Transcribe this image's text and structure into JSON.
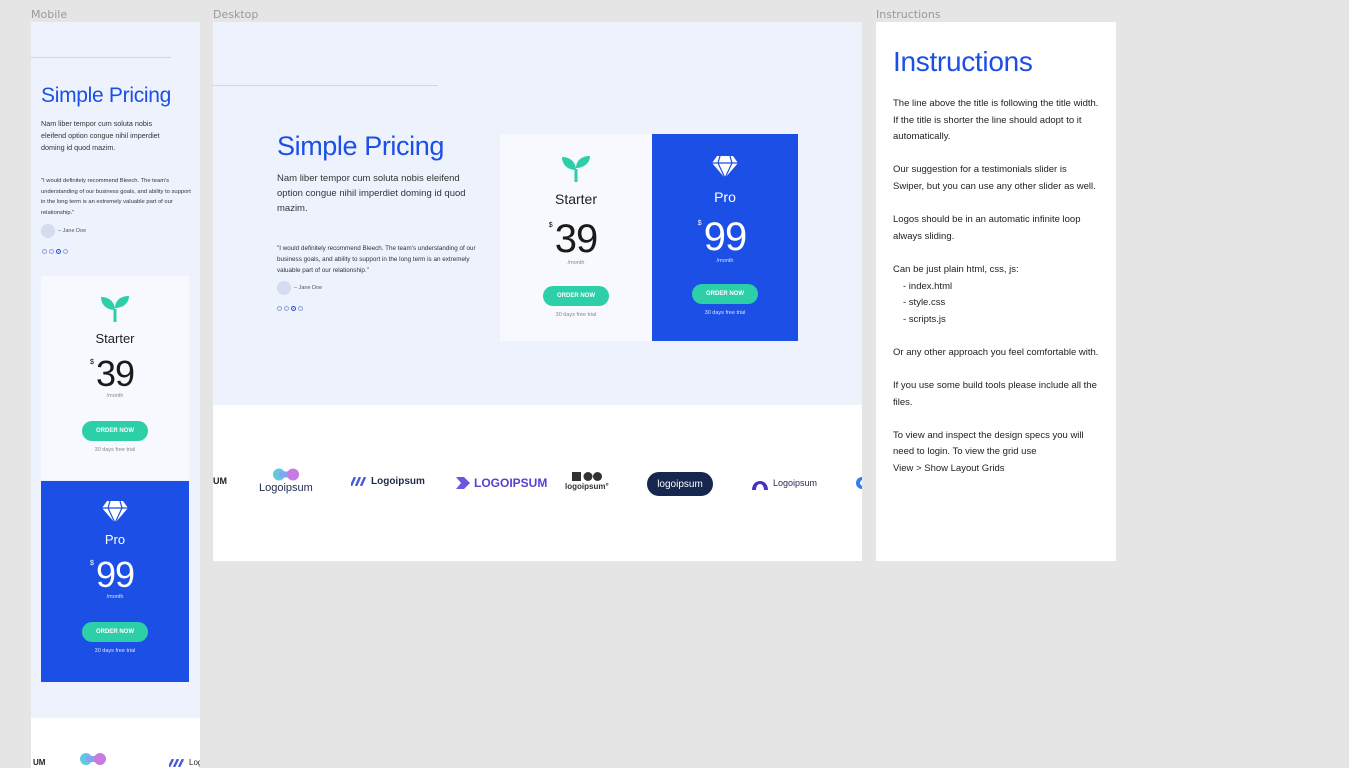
{
  "frames": {
    "mobile_label": "Mobile",
    "desktop_label": "Desktop",
    "instructions_label": "Instructions"
  },
  "colors": {
    "brand_blue": "#1c4fe6",
    "accent_green": "#2ccfa7",
    "hero_bg": "#eef2fd"
  },
  "hero": {
    "title": "Simple Pricing",
    "description": "Nam liber tempor cum soluta nobis eleifend option congue nihil imperdiet doming id quod mazim.",
    "testimonial": "\"I would definitely recommend Bleech. The team's understanding of our business goals, and ability to support in the long term is an extremely valuable part of our relationship.\"",
    "author": "– Jane Doe",
    "slider_dots": 4,
    "active_dot": 3
  },
  "plans": {
    "starter": {
      "icon": "sprout-icon",
      "name": "Starter",
      "currency": "$",
      "price": "39",
      "period": "/month",
      "cta": "ORDER NOW",
      "trial": "30 days free trial"
    },
    "pro": {
      "icon": "diamond-icon",
      "name": "Pro",
      "currency": "$",
      "price": "99",
      "period": "/month",
      "cta": "ORDER NOW",
      "trial": "30 days free trial"
    }
  },
  "logos": {
    "items": [
      "UM",
      "Logoipsum",
      "Logoipsum",
      "LOGOIPSUM",
      "logoipsum°",
      "logoipsum",
      "Logoipsum"
    ]
  },
  "instructions": {
    "title": "Instructions",
    "p1": "The line above the title is following the title width. If the title is shorter the line should adopt to it automatically.",
    "p2": "Our suggestion for a testimonials slider is Swiper, but you can use any other slider as well.",
    "p3": "Logos should be in an automatic infinite loop always sliding.",
    "p4_intro": "Can be just plain html, css, js:",
    "file1": "- index.html",
    "file2": "- style.css",
    "file3": "- scripts.js",
    "p5": "Or any other approach you feel comfortable with.",
    "p6": "If you use some build tools please include all the files.",
    "p7a": "To view and inspect the design specs you will need to login. To view the grid use",
    "p7b": "View > Show Layout Grids"
  }
}
